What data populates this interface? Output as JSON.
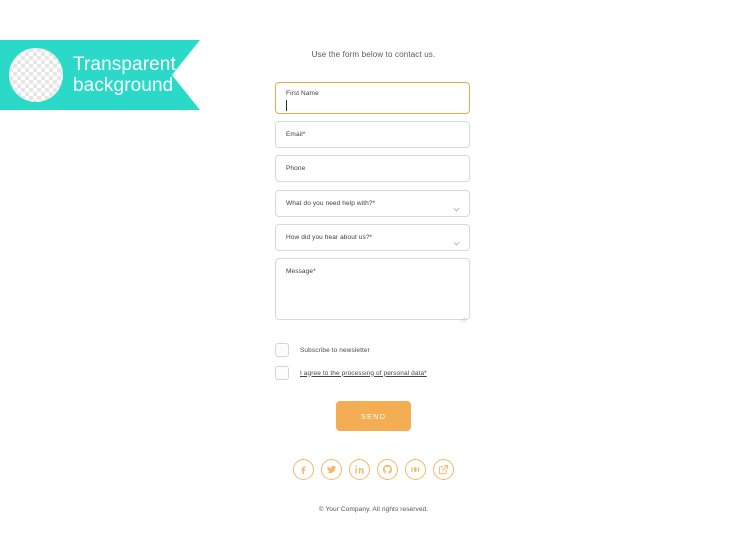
{
  "badge": {
    "line1": "Transparent",
    "line2": "background",
    "bg_color": "#2BD9C8",
    "circle_icon": "transparent-checkerboard-circle"
  },
  "form": {
    "intro": "Use the form below to contact us.",
    "accent_color": "#F5AD53",
    "fields": [
      {
        "name": "first-name",
        "label": "First Name",
        "value": "",
        "focused": true
      },
      {
        "name": "email",
        "label": "Email*",
        "value": ""
      },
      {
        "name": "phone",
        "label": "Phone",
        "value": ""
      },
      {
        "name": "help-topic",
        "label": "What do you need help with?*",
        "value": "",
        "icon": "chevron-down-icon"
      },
      {
        "name": "referral-source",
        "label": "How did you hear about us?*",
        "value": "",
        "icon": "chevron-down-icon"
      },
      {
        "name": "message",
        "label": "Message*",
        "value": ""
      }
    ],
    "checkboxes": [
      {
        "name": "newsletter",
        "label": "Subscribe to newsletter",
        "checked": false
      },
      {
        "name": "gdpr-consent",
        "label": "I agree to the processing of personal data*",
        "checked": false
      }
    ],
    "submit_label": "SEND"
  },
  "social": {
    "items": [
      {
        "name": "facebook",
        "icon": "facebook-icon"
      },
      {
        "name": "twitter",
        "icon": "twitter-icon"
      },
      {
        "name": "linkedin",
        "icon": "linkedin-icon"
      },
      {
        "name": "github",
        "icon": "github-icon"
      },
      {
        "name": "medium",
        "icon": "medium-icon"
      },
      {
        "name": "external-link",
        "icon": "external-link-icon"
      }
    ]
  },
  "footer": {
    "copyright": "© Your Company. All rights reserved."
  }
}
